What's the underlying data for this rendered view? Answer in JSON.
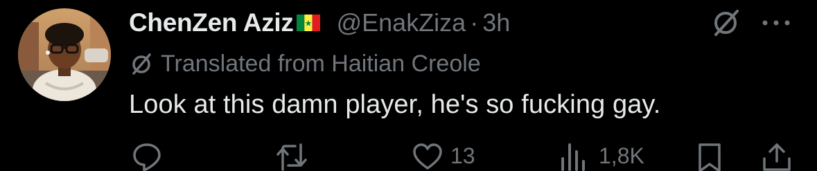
{
  "tweet": {
    "display_name": "ChenZen Aziz",
    "flag_icon": "senegal-flag-icon",
    "handle": "@EnakZiza",
    "separator": "·",
    "time": "3h",
    "translation_note": "Translated from Haitian Creole",
    "text": "Look at this damn player, he's so fucking gay.",
    "likes": "13",
    "views": "1,8K"
  },
  "icons": {
    "grok": "grok-icon",
    "more": "more-icon",
    "reply": "reply-icon",
    "retweet": "retweet-icon",
    "like": "heart-icon",
    "views": "views-icon",
    "bookmark": "bookmark-icon",
    "share": "share-icon"
  },
  "colors": {
    "background": "#000000",
    "primary_text": "#e7e9ea",
    "secondary_text": "#71767b"
  }
}
